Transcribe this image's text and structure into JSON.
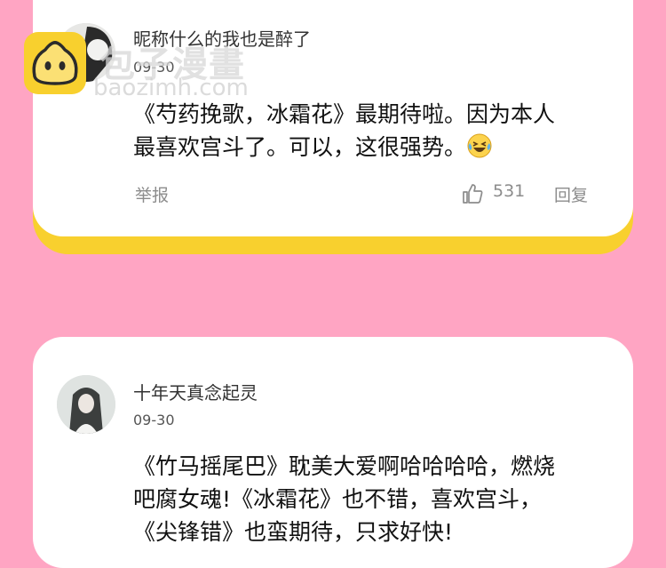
{
  "watermark": {
    "name": "包子漫畫",
    "url": "baozimh.com"
  },
  "comments": [
    {
      "username": "昵称什么的我也是醉了",
      "date": "09-30",
      "lines": [
        "《芍药挽歌，冰霜花》最期待啦。因为本人",
        "最喜欢宫斗了。可以，这很强势。"
      ],
      "report_label": "举报",
      "likes": "531",
      "reply_label": "回复"
    },
    {
      "username": "十年天真念起灵",
      "date": "09-30",
      "lines": [
        "《竹马摇尾巴》耽美大爱啊哈哈哈哈，燃烧",
        "吧腐女魂!《冰霜花》也不错，喜欢宫斗，",
        "《尖锋错》也蛮期待，只求好快!"
      ]
    }
  ],
  "colors": {
    "background": "#ffa5c3",
    "card": "#ffffff",
    "accent": "#f8d02e"
  }
}
